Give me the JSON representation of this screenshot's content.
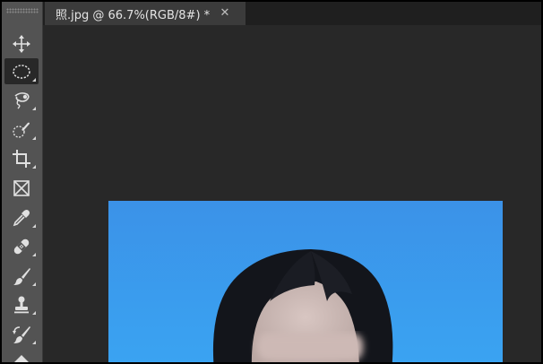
{
  "document_tab": {
    "title": "照.jpg @ 66.7%(RGB/8#) *",
    "close_glyph": "✕"
  },
  "toolbar": {
    "tools": [
      {
        "name": "move-tool",
        "icon": "move-icon",
        "active": false
      },
      {
        "name": "elliptical-marquee-tool",
        "icon": "elliptical-marquee-icon",
        "active": true
      },
      {
        "name": "lasso-tool",
        "icon": "lasso-icon",
        "active": false
      },
      {
        "name": "quick-selection-tool",
        "icon": "quick-selection-icon",
        "active": false
      },
      {
        "name": "crop-tool",
        "icon": "crop-icon",
        "active": false
      },
      {
        "name": "frame-tool",
        "icon": "frame-icon",
        "active": false
      },
      {
        "name": "eyedropper-tool",
        "icon": "eyedropper-icon",
        "active": false
      },
      {
        "name": "spot-healing-tool",
        "icon": "bandage-icon",
        "active": false
      },
      {
        "name": "brush-tool",
        "icon": "brush-icon",
        "active": false
      },
      {
        "name": "clone-stamp-tool",
        "icon": "stamp-icon",
        "active": false
      },
      {
        "name": "history-brush-tool",
        "icon": "history-brush-icon",
        "active": false
      },
      {
        "name": "eraser-tool",
        "icon": "eraser-icon",
        "active": false
      }
    ]
  },
  "colors": {
    "toolbar_bg": "#535353",
    "workspace_bg": "#282828",
    "tab_bg": "#3b3b3b",
    "photo_background": "#3d9cee",
    "hair": "#14161c",
    "skin": "#c9b7b3"
  }
}
